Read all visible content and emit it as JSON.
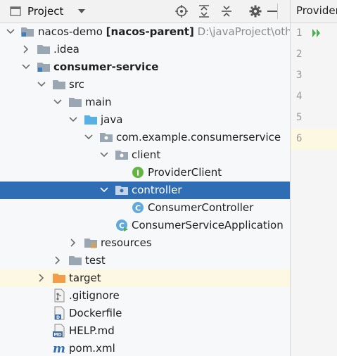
{
  "toolbar": {
    "title": "Project"
  },
  "editor": {
    "tab_label": "ProviderClient.java",
    "line_numbers": [
      "1",
      "2",
      "3",
      "4",
      "5",
      "6"
    ]
  },
  "tree": {
    "root_name": "nacos-demo",
    "root_module": "[nacos-parent]",
    "root_path": "D:\\javaProject\\other",
    "idea": ".idea",
    "consumer_service": "consumer-service",
    "src": "src",
    "main": "main",
    "java": "java",
    "package": "com.example.consumerservice",
    "client": "client",
    "provider_client": "ProviderClient",
    "controller": "controller",
    "consumer_controller": "ConsumerController",
    "application": "ConsumerServiceApplication",
    "resources": "resources",
    "test": "test",
    "target": "target",
    "gitignore": ".gitignore",
    "dockerfile": "Dockerfile",
    "help": "HELP.md",
    "pom": "pom.xml"
  }
}
